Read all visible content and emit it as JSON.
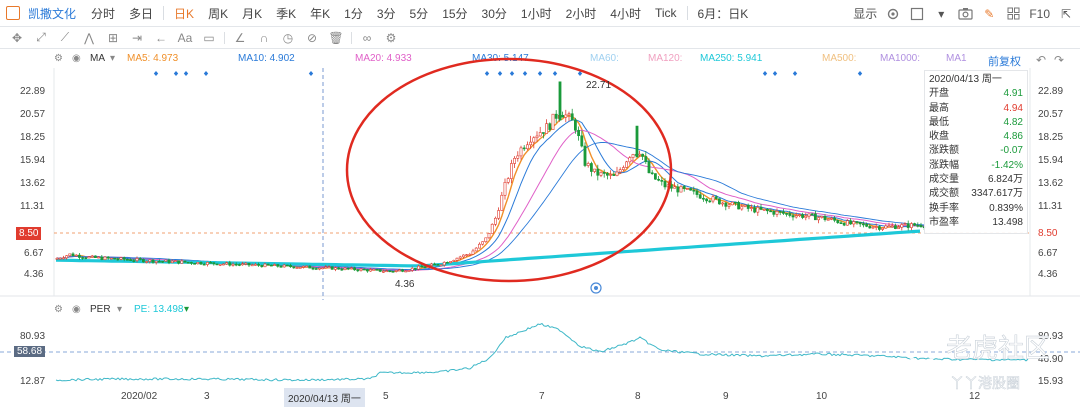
{
  "app": {
    "stock_name": "凯撒文化",
    "periods": [
      "分时",
      "多日",
      "日K",
      "周K",
      "月K",
      "季K",
      "年K",
      "1分",
      "3分",
      "5分",
      "15分",
      "30分",
      "1小时",
      "2小时",
      "4小时",
      "Tick",
      "6月：日K"
    ],
    "active_period": "日K",
    "display_label": "显示",
    "f10_label": "F10"
  },
  "legend": {
    "ma": "MA",
    "ma5": "MA5: 4.973",
    "ma10": "MA10: 4.902",
    "ma20": "MA20: 4.933",
    "ma30": "MA30: 5.147",
    "ma60": "MA60:",
    "ma120": "MA120:",
    "ma250": "MA250: 5.941",
    "ma500": "MA500:",
    "ma1000": "MA1000:",
    "ma1": "MA1",
    "fq": "前复权",
    "colors": {
      "ma5": "#f0902a",
      "ma10": "#2a7ad8",
      "ma20": "#e060c8",
      "ma30": "#2a7ad8",
      "ma60": "#9fd0f0",
      "ma120": "#f0a0c0",
      "ma250": "#1ec8d8",
      "ma500": "#f0c080",
      "ma1000": "#b090e0"
    }
  },
  "price_axis": [
    "22.89",
    "20.57",
    "18.25",
    "15.94",
    "13.62",
    "11.31",
    "8.50",
    "6.67",
    "4.36"
  ],
  "current_price": "8.50",
  "annotations": {
    "high": "22.71",
    "low": "4.36"
  },
  "info_panel": {
    "date": "2020/04/13 周一",
    "rows": [
      {
        "label": "开盘",
        "value": "4.91",
        "color": "#1a9a3a"
      },
      {
        "label": "最高",
        "value": "4.94",
        "color": "#e03b2e"
      },
      {
        "label": "最低",
        "value": "4.82",
        "color": "#1a9a3a"
      },
      {
        "label": "收盘",
        "value": "4.86",
        "color": "#1a9a3a"
      },
      {
        "label": "涨跌额",
        "value": "-0.07",
        "color": "#1a9a3a"
      },
      {
        "label": "涨跌幅",
        "value": "-1.42%",
        "color": "#1a9a3a"
      },
      {
        "label": "成交量",
        "value": "6.824万",
        "color": "#333333"
      },
      {
        "label": "成交额",
        "value": "3347.617万",
        "color": "#333333"
      },
      {
        "label": "换手率",
        "value": "0.839%",
        "color": "#333333"
      },
      {
        "label": "市盈率",
        "value": "13.498",
        "color": "#333333"
      }
    ]
  },
  "per": {
    "name": "PER",
    "pe": "PE: 13.498",
    "axis_left": [
      "80.93",
      "58.68",
      "12.87"
    ],
    "axis_right": [
      "80.93",
      "46.90",
      "15.93"
    ]
  },
  "x_axis": {
    "labels": [
      "2020/02",
      "3",
      "5",
      "7",
      "8",
      "9",
      "10",
      "12"
    ],
    "cursor": "2020/04/13 周一"
  },
  "watermarks": {
    "main": "老虎社区",
    "sub": "丫丫港股圈"
  }
}
